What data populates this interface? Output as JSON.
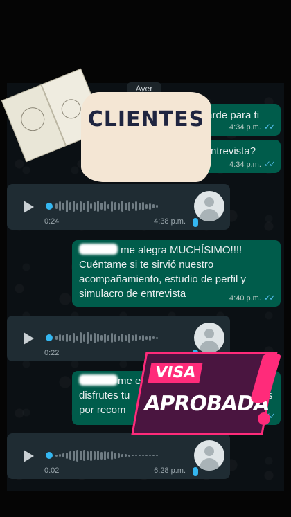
{
  "chat": {
    "date_chip": "Ayer",
    "messages": [
      {
        "text": "tarde para ti",
        "time": "4:34 p.m."
      },
      {
        "text": "ntrevista?",
        "time": "4:34 p.m."
      }
    ],
    "voice_notes": [
      {
        "duration": "0:24",
        "time": "4:38 p.m."
      },
      {
        "duration": "0:22",
        "time": ""
      },
      {
        "duration": "0:02",
        "time": "6:28 p.m."
      }
    ],
    "long_message": {
      "line1_suffix": "me alegra MUCHÍSIMO!!!!",
      "line2": "Cuéntame si te sirvió nuestro",
      "line3": "acompañamiento, estudio de perfil y",
      "line4": "simulacro de entrevista",
      "time": "4:40 p.m."
    },
    "partial_message": {
      "line1_suffix": "me e",
      "line2": "disfrutes tu",
      "line2_tail": "s",
      "line3": "por recom"
    }
  },
  "overlays": {
    "note_label": "CLIENTES",
    "badge_top": "VISA",
    "badge_bottom": "APROBADA"
  },
  "colors": {
    "outgoing": "#005c4b",
    "incoming": "#1f2c33",
    "read_ticks": "#53bdeb",
    "badge_accent": "#ff2b7a",
    "badge_fill": "#4a1540"
  },
  "icons": [
    "play-icon",
    "mic-icon",
    "avatar-icon",
    "double-check-icon"
  ]
}
